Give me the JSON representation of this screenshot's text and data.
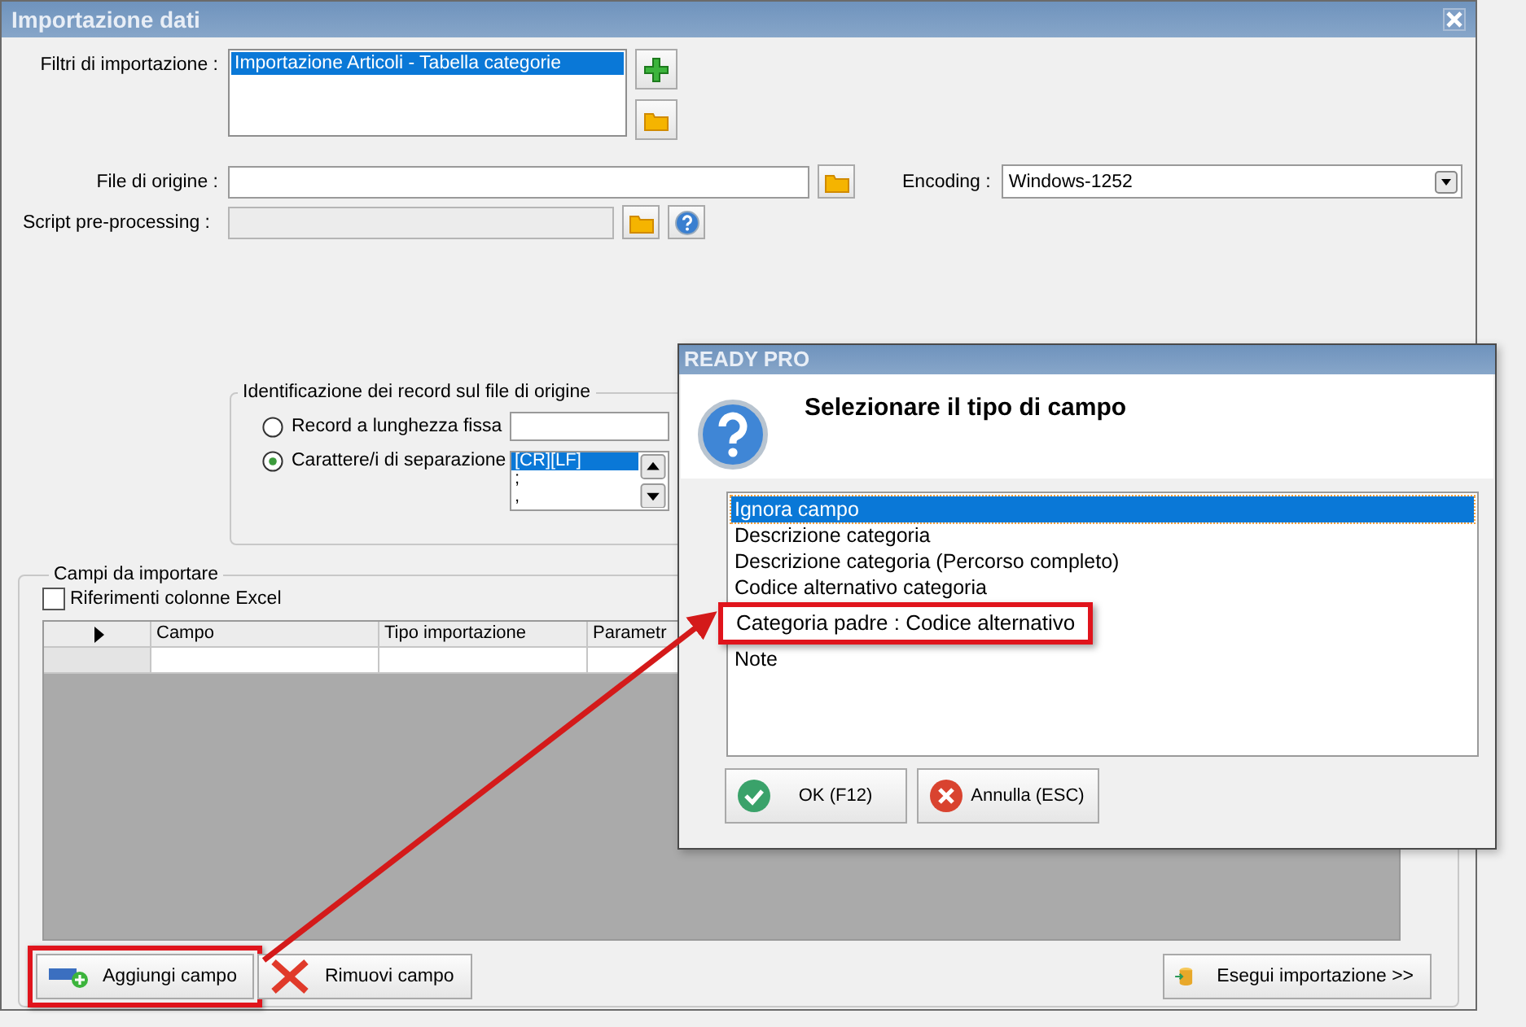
{
  "window": {
    "title": "Importazione dati"
  },
  "filters": {
    "label": "Filtri di importazione :",
    "items": [
      {
        "text": "Importazione Articoli - Tabella categorie",
        "selected": true
      }
    ]
  },
  "source_file": {
    "label": "File di origine :"
  },
  "encoding": {
    "label": "Encoding :",
    "value": "Windows-1252"
  },
  "script": {
    "label": "Script pre-processing :",
    "disabled": true
  },
  "record_group": {
    "title": "Identificazione dei record sul file di origine",
    "options": [
      {
        "label": "Record a lunghezza fissa",
        "selected": false
      },
      {
        "label": "Carattere/i di separazione",
        "selected": true
      }
    ],
    "separators": [
      {
        "text": "[CR][LF]",
        "selected": true
      },
      {
        "text": ";",
        "selected": false
      },
      {
        "text": ",",
        "selected": false
      }
    ]
  },
  "fields_group": {
    "title": "Campi da importare",
    "excel_refs": {
      "label": "Riferimenti colonne Excel",
      "checked": false
    },
    "columns": [
      "Campo",
      "Tipo importazione",
      "Parametr"
    ]
  },
  "buttons": [
    {
      "label": "Aggiungi campo",
      "kind": "add",
      "highlighted": true
    },
    {
      "label": "Rimuovi campo",
      "kind": "remove",
      "highlighted": false
    }
  ],
  "run_button": {
    "label": "Esegui importazione >>"
  },
  "dialog": {
    "title": "READY PRO",
    "heading": "Selezionare il tipo di campo",
    "items": [
      {
        "text": "Ignora campo",
        "selected": true,
        "highlighted": false
      },
      {
        "text": "Descrizione categoria",
        "selected": false,
        "highlighted": false
      },
      {
        "text": "Descrizione categoria (Percorso completo)",
        "selected": false,
        "highlighted": false
      },
      {
        "text": "Codice alternativo categoria",
        "selected": false,
        "highlighted": false
      },
      {
        "text": "Categoria padre : Codice alternativo",
        "selected": false,
        "highlighted": true
      },
      {
        "text": "Note",
        "selected": false,
        "highlighted": false
      }
    ],
    "buttons": [
      {
        "label": "OK (F12)",
        "kind": "ok"
      },
      {
        "label": "Annulla (ESC)",
        "kind": "cancel"
      }
    ]
  }
}
